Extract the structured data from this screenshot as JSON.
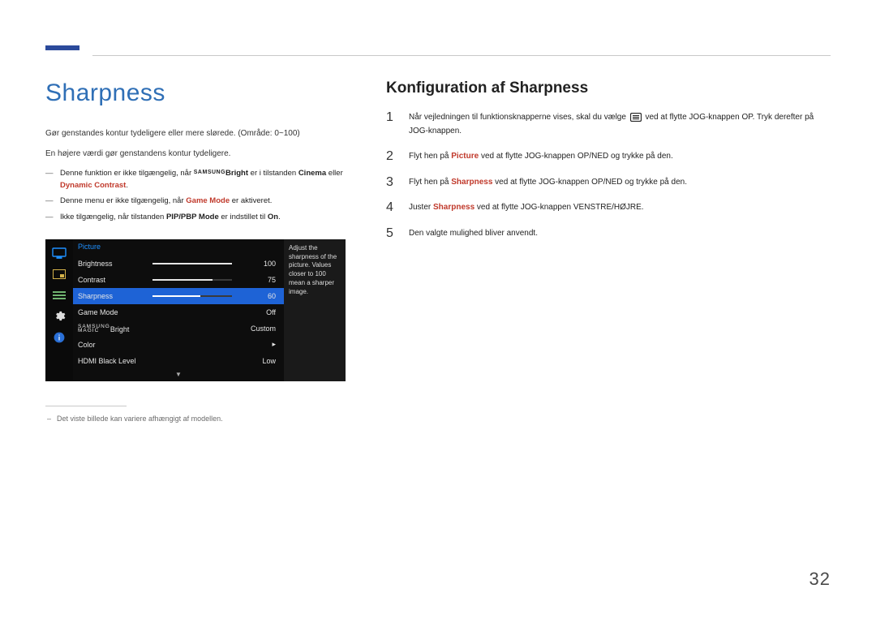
{
  "pageNumber": "32",
  "left": {
    "title": "Sharpness",
    "intro1": "Gør genstandes kontur tydeligere eller mere slørede. (Område: 0~100)",
    "intro2": "En højere værdi gør genstandens kontur tydeligere.",
    "dash1_pre": "Denne funktion er ikke tilgængelig, når ",
    "dash1_magic_prefix": "SAMSUNG",
    "dash1_magic_suffix": "Bright",
    "dash1_mid": " er i tilstanden ",
    "dash1_bold1": "Cinema",
    "dash1_mid2": " eller ",
    "dash1_bold2": "Dynamic Contrast",
    "dash1_end": ".",
    "dash2_pre": "Denne menu er ikke tilgængelig, når ",
    "dash2_bold": "Game Mode",
    "dash2_end": " er aktiveret.",
    "dash3_pre": "Ikke tilgængelig, når tilstanden ",
    "dash3_bold": "PIP/PBP Mode",
    "dash3_mid": " er indstillet til ",
    "dash3_bold2": "On",
    "dash3_end": ".",
    "footnote": "Det viste billede kan variere afhængigt af modellen."
  },
  "osd": {
    "header": "Picture",
    "desc": "Adjust the sharpness of the picture. Values closer to 100 mean a sharper image.",
    "rows": [
      {
        "label": "Brightness",
        "value": "100",
        "bar": 100,
        "type": "bar"
      },
      {
        "label": "Contrast",
        "value": "75",
        "bar": 75,
        "type": "bar"
      },
      {
        "label": "Sharpness",
        "value": "60",
        "bar": 60,
        "type": "bar",
        "selected": true
      },
      {
        "label": "Game Mode",
        "value": "Off",
        "type": "text"
      },
      {
        "labelPrefix": "SAMSUNG",
        "labelMagic": "MAGIC",
        "labelSuffix": "Bright",
        "value": "Custom",
        "type": "text",
        "magic": true
      },
      {
        "label": "Color",
        "value": "",
        "type": "arrow"
      },
      {
        "label": "HDMI Black Level",
        "value": "Low",
        "type": "text"
      }
    ],
    "footerArrow": "▼"
  },
  "right": {
    "title": "Konfiguration af Sharpness",
    "steps": [
      {
        "num": "1",
        "segments": [
          {
            "t": "Når vejledningen til funktionsknapperne vises, skal du vælge "
          },
          {
            "icon": true
          },
          {
            "t": " ved at flytte JOG-knappen OP. Tryk derefter på JOG-knappen."
          }
        ]
      },
      {
        "num": "2",
        "segments": [
          {
            "t": "Flyt hen på "
          },
          {
            "bold": true,
            "red": true,
            "t": "Picture"
          },
          {
            "t": " ved at flytte JOG-knappen OP/NED og trykke på den."
          }
        ]
      },
      {
        "num": "3",
        "segments": [
          {
            "t": "Flyt hen på "
          },
          {
            "bold": true,
            "red": true,
            "t": "Sharpness"
          },
          {
            "t": " ved at flytte JOG-knappen OP/NED og trykke på den."
          }
        ]
      },
      {
        "num": "4",
        "segments": [
          {
            "t": "Juster "
          },
          {
            "bold": true,
            "red": true,
            "t": "Sharpness"
          },
          {
            "t": " ved at flytte JOG-knappen VENSTRE/HØJRE."
          }
        ]
      },
      {
        "num": "5",
        "segments": [
          {
            "t": "Den valgte mulighed bliver anvendt."
          }
        ]
      }
    ]
  }
}
